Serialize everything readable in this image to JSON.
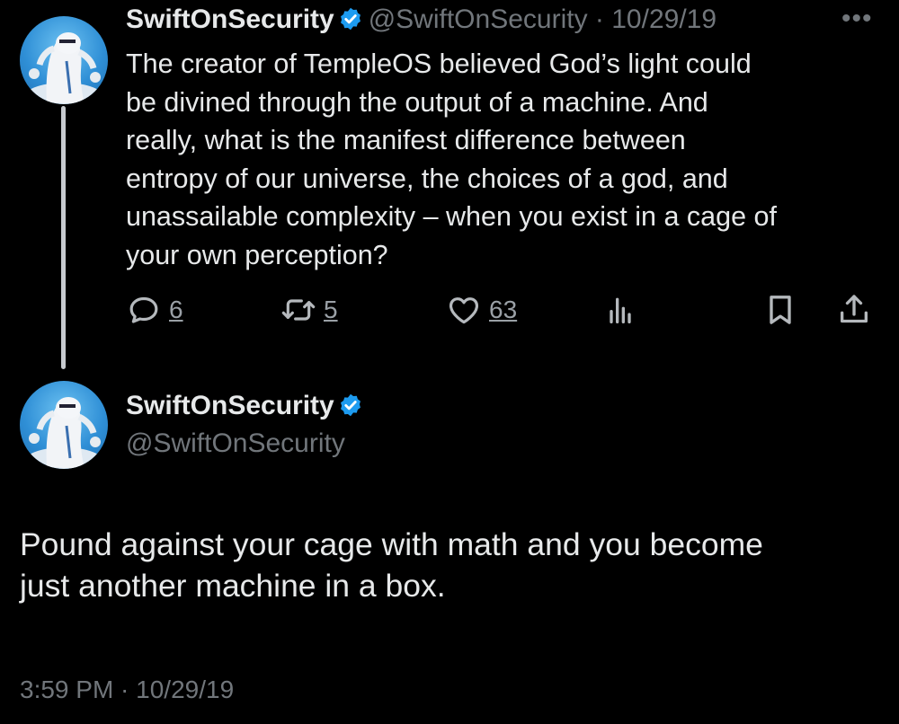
{
  "colors": {
    "background": "#000000",
    "primary_text": "#e7e9ea",
    "secondary_text": "#71767b",
    "verified_badge": "#1d9bf0"
  },
  "tweet1": {
    "display_name": "SwiftOnSecurity",
    "handle": "@SwiftOnSecurity",
    "separator": " · ",
    "date": "10/29/19",
    "more_icon": "more-horizontal-icon",
    "text_lines": [
      "The creator of TempleOS believed God’s light could",
      "be divined through the output of a machine. And",
      "really, what is the manifest difference between",
      "entropy of our universe, the choices of a god, and",
      "unassailable complexity – when you exist in a cage of",
      "your own perception?"
    ],
    "actions": {
      "reply_count": "6",
      "retweet_count": "5",
      "like_count": "63"
    }
  },
  "tweet2": {
    "display_name": "SwiftOnSecurity",
    "handle": "@SwiftOnSecurity",
    "text_lines": [
      "Pound against your cage with math and you become",
      "just another machine in a box."
    ],
    "timestamp": "3:59 PM · 10/29/19"
  }
}
